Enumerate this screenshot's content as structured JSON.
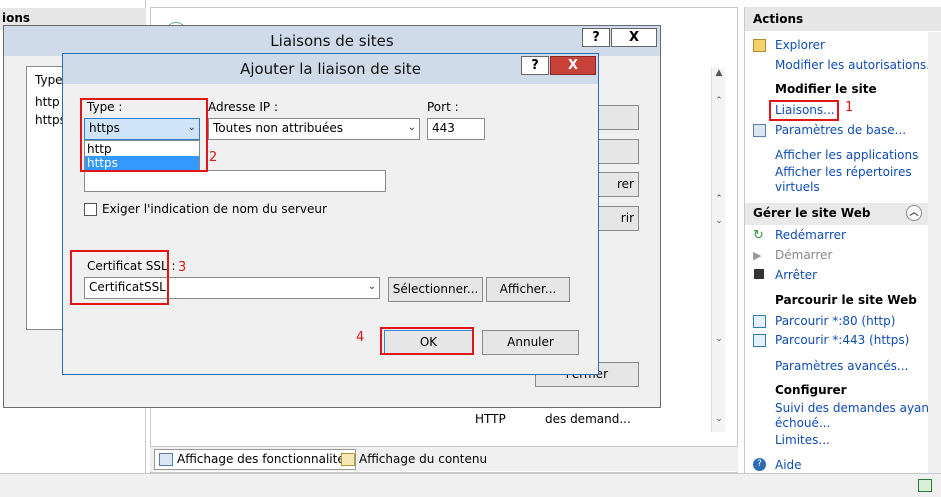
{
  "left_pane": {
    "title": "ions"
  },
  "center": {
    "rows": [
      {
        "col1": "HTTP",
        "col2": "des demand..."
      }
    ],
    "tabs": [
      {
        "label": "Affichage des fonctionnalités"
      },
      {
        "label": "Affichage du contenu"
      }
    ]
  },
  "actions": {
    "title": "Actions",
    "explore": "Explorer",
    "edit_permissions": "Modifier les autorisations...",
    "edit_site_heading": "Modifier le site",
    "bindings": "Liaisons...",
    "basic_settings": "Paramètres de base...",
    "view_apps": "Afficher les applications",
    "view_dirs_1": "Afficher les répertoires",
    "view_dirs_2": "virtuels",
    "manage_site": "Gérer le site Web",
    "restart": "Redémarrer",
    "start": "Démarrer",
    "stop": "Arrêter",
    "browse_heading": "Parcourir le site Web",
    "browse_80": "Parcourir *:80 (http)",
    "browse_443": "Parcourir *:443 (https)",
    "advanced": "Paramètres avancés...",
    "configure_heading": "Configurer",
    "failed_1": "Suivi des demandes ayant",
    "failed_2": "échoué...",
    "limits": "Limites...",
    "help": "Aide"
  },
  "bindings_dialog": {
    "title": "Liaisons de sites",
    "help_btn": "?",
    "close_btn": "X",
    "col_type": "Type",
    "rows": [
      "http",
      "https"
    ],
    "btn_close_partial": "Fermer",
    "btn_partial_1": "rer",
    "btn_partial_2": "rir"
  },
  "add_dialog": {
    "title": "Ajouter la liaison de site",
    "help_btn": "?",
    "close_btn": "X",
    "type_label": "Type :",
    "type_value": "https",
    "type_options": [
      "http",
      "https"
    ],
    "ip_label": "Adresse IP :",
    "ip_value": "Toutes non attribuées",
    "port_label": "Port :",
    "port_value": "443",
    "hostname_value": "",
    "sni_label": "Exiger l'indication de nom du serveur",
    "ssl_label": "Certificat SSL :",
    "ssl_value": "CertificatSSL",
    "select_btn": "Sélectionner...",
    "view_btn": "Afficher...",
    "ok_btn": "OK",
    "cancel_btn": "Annuler"
  },
  "annotations": {
    "n1": "1",
    "n2": "2",
    "n3": "3",
    "n4": "4"
  },
  "colors": {
    "annotation": "#e0161a",
    "link": "#0f4cb2",
    "titlebar": "#cfdbe8",
    "close_red": "#c8423a"
  }
}
